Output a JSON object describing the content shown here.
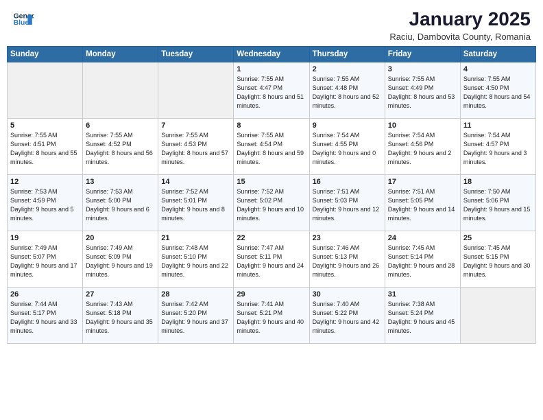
{
  "header": {
    "title": "January 2025",
    "subtitle": "Raciu, Dambovita County, Romania"
  },
  "days": [
    {
      "num": "",
      "sunrise": "",
      "sunset": "",
      "daylight": "",
      "empty": true
    },
    {
      "num": "",
      "sunrise": "",
      "sunset": "",
      "daylight": "",
      "empty": true
    },
    {
      "num": "",
      "sunrise": "",
      "sunset": "",
      "daylight": "",
      "empty": true
    },
    {
      "num": "1",
      "sunrise": "Sunrise: 7:55 AM",
      "sunset": "Sunset: 4:47 PM",
      "daylight": "Daylight: 8 hours and 51 minutes."
    },
    {
      "num": "2",
      "sunrise": "Sunrise: 7:55 AM",
      "sunset": "Sunset: 4:48 PM",
      "daylight": "Daylight: 8 hours and 52 minutes."
    },
    {
      "num": "3",
      "sunrise": "Sunrise: 7:55 AM",
      "sunset": "Sunset: 4:49 PM",
      "daylight": "Daylight: 8 hours and 53 minutes."
    },
    {
      "num": "4",
      "sunrise": "Sunrise: 7:55 AM",
      "sunset": "Sunset: 4:50 PM",
      "daylight": "Daylight: 8 hours and 54 minutes."
    },
    {
      "num": "5",
      "sunrise": "Sunrise: 7:55 AM",
      "sunset": "Sunset: 4:51 PM",
      "daylight": "Daylight: 8 hours and 55 minutes."
    },
    {
      "num": "6",
      "sunrise": "Sunrise: 7:55 AM",
      "sunset": "Sunset: 4:52 PM",
      "daylight": "Daylight: 8 hours and 56 minutes."
    },
    {
      "num": "7",
      "sunrise": "Sunrise: 7:55 AM",
      "sunset": "Sunset: 4:53 PM",
      "daylight": "Daylight: 8 hours and 57 minutes."
    },
    {
      "num": "8",
      "sunrise": "Sunrise: 7:55 AM",
      "sunset": "Sunset: 4:54 PM",
      "daylight": "Daylight: 8 hours and 59 minutes."
    },
    {
      "num": "9",
      "sunrise": "Sunrise: 7:54 AM",
      "sunset": "Sunset: 4:55 PM",
      "daylight": "Daylight: 9 hours and 0 minutes."
    },
    {
      "num": "10",
      "sunrise": "Sunrise: 7:54 AM",
      "sunset": "Sunset: 4:56 PM",
      "daylight": "Daylight: 9 hours and 2 minutes."
    },
    {
      "num": "11",
      "sunrise": "Sunrise: 7:54 AM",
      "sunset": "Sunset: 4:57 PM",
      "daylight": "Daylight: 9 hours and 3 minutes."
    },
    {
      "num": "12",
      "sunrise": "Sunrise: 7:53 AM",
      "sunset": "Sunset: 4:59 PM",
      "daylight": "Daylight: 9 hours and 5 minutes."
    },
    {
      "num": "13",
      "sunrise": "Sunrise: 7:53 AM",
      "sunset": "Sunset: 5:00 PM",
      "daylight": "Daylight: 9 hours and 6 minutes."
    },
    {
      "num": "14",
      "sunrise": "Sunrise: 7:52 AM",
      "sunset": "Sunset: 5:01 PM",
      "daylight": "Daylight: 9 hours and 8 minutes."
    },
    {
      "num": "15",
      "sunrise": "Sunrise: 7:52 AM",
      "sunset": "Sunset: 5:02 PM",
      "daylight": "Daylight: 9 hours and 10 minutes."
    },
    {
      "num": "16",
      "sunrise": "Sunrise: 7:51 AM",
      "sunset": "Sunset: 5:03 PM",
      "daylight": "Daylight: 9 hours and 12 minutes."
    },
    {
      "num": "17",
      "sunrise": "Sunrise: 7:51 AM",
      "sunset": "Sunset: 5:05 PM",
      "daylight": "Daylight: 9 hours and 14 minutes."
    },
    {
      "num": "18",
      "sunrise": "Sunrise: 7:50 AM",
      "sunset": "Sunset: 5:06 PM",
      "daylight": "Daylight: 9 hours and 15 minutes."
    },
    {
      "num": "19",
      "sunrise": "Sunrise: 7:49 AM",
      "sunset": "Sunset: 5:07 PM",
      "daylight": "Daylight: 9 hours and 17 minutes."
    },
    {
      "num": "20",
      "sunrise": "Sunrise: 7:49 AM",
      "sunset": "Sunset: 5:09 PM",
      "daylight": "Daylight: 9 hours and 19 minutes."
    },
    {
      "num": "21",
      "sunrise": "Sunrise: 7:48 AM",
      "sunset": "Sunset: 5:10 PM",
      "daylight": "Daylight: 9 hours and 22 minutes."
    },
    {
      "num": "22",
      "sunrise": "Sunrise: 7:47 AM",
      "sunset": "Sunset: 5:11 PM",
      "daylight": "Daylight: 9 hours and 24 minutes."
    },
    {
      "num": "23",
      "sunrise": "Sunrise: 7:46 AM",
      "sunset": "Sunset: 5:13 PM",
      "daylight": "Daylight: 9 hours and 26 minutes."
    },
    {
      "num": "24",
      "sunrise": "Sunrise: 7:45 AM",
      "sunset": "Sunset: 5:14 PM",
      "daylight": "Daylight: 9 hours and 28 minutes."
    },
    {
      "num": "25",
      "sunrise": "Sunrise: 7:45 AM",
      "sunset": "Sunset: 5:15 PM",
      "daylight": "Daylight: 9 hours and 30 minutes."
    },
    {
      "num": "26",
      "sunrise": "Sunrise: 7:44 AM",
      "sunset": "Sunset: 5:17 PM",
      "daylight": "Daylight: 9 hours and 33 minutes."
    },
    {
      "num": "27",
      "sunrise": "Sunrise: 7:43 AM",
      "sunset": "Sunset: 5:18 PM",
      "daylight": "Daylight: 9 hours and 35 minutes."
    },
    {
      "num": "28",
      "sunrise": "Sunrise: 7:42 AM",
      "sunset": "Sunset: 5:20 PM",
      "daylight": "Daylight: 9 hours and 37 minutes."
    },
    {
      "num": "29",
      "sunrise": "Sunrise: 7:41 AM",
      "sunset": "Sunset: 5:21 PM",
      "daylight": "Daylight: 9 hours and 40 minutes."
    },
    {
      "num": "30",
      "sunrise": "Sunrise: 7:40 AM",
      "sunset": "Sunset: 5:22 PM",
      "daylight": "Daylight: 9 hours and 42 minutes."
    },
    {
      "num": "31",
      "sunrise": "Sunrise: 7:38 AM",
      "sunset": "Sunset: 5:24 PM",
      "daylight": "Daylight: 9 hours and 45 minutes."
    },
    {
      "num": "",
      "sunrise": "",
      "sunset": "",
      "daylight": "",
      "empty": true
    }
  ]
}
